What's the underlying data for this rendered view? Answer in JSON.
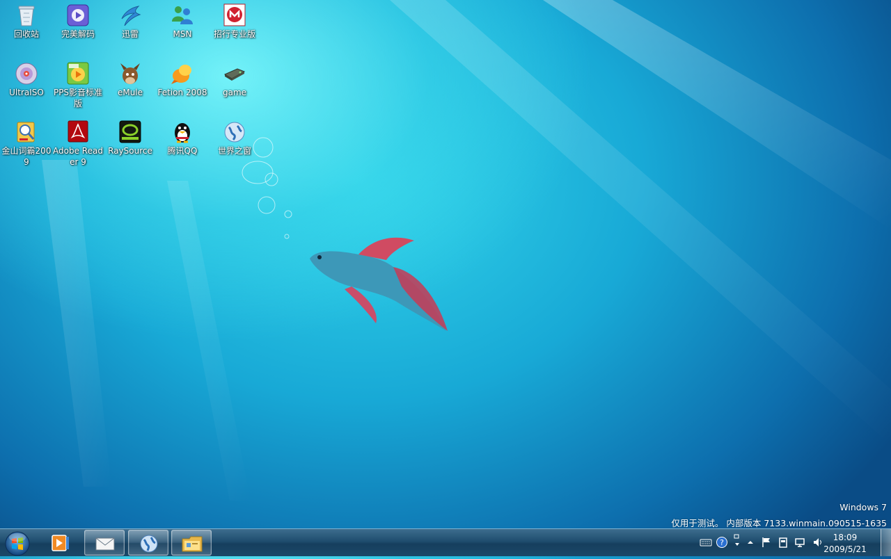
{
  "desktop": {
    "icons": [
      {
        "label": "回收站",
        "icon": "recycle-bin-icon"
      },
      {
        "label": "完美解码",
        "icon": "media-player-icon"
      },
      {
        "label": "迅雷",
        "icon": "thunder-download-icon"
      },
      {
        "label": "MSN",
        "icon": "msn-messenger-icon"
      },
      {
        "label": "招行专业版",
        "icon": "cmb-bank-icon"
      },
      {
        "label": "UltraISO",
        "icon": "disc-icon"
      },
      {
        "label": "PPS影音标准版",
        "icon": "pps-player-icon"
      },
      {
        "label": "eMule",
        "icon": "emule-mule-icon"
      },
      {
        "label": "Fetion 2008",
        "icon": "fetion-icon"
      },
      {
        "label": "game",
        "icon": "game-drive-icon"
      },
      {
        "label": "金山词霸2009",
        "icon": "dictionary-icon"
      },
      {
        "label": "Adobe Reader 9",
        "icon": "adobe-reader-icon"
      },
      {
        "label": "RaySource",
        "icon": "raysource-icon"
      },
      {
        "label": "腾讯QQ",
        "icon": "qq-penguin-icon"
      },
      {
        "label": "世界之窗",
        "icon": "world-browser-icon"
      }
    ]
  },
  "watermark": {
    "line1": "Windows 7",
    "line2": "仅用于测试。 内部版本 7133.winmain.090515-1635"
  },
  "taskbar": {
    "start_icon": "windows-orb-icon",
    "buttons": [
      {
        "icon": "media-player-icon",
        "state": "pinned"
      },
      {
        "icon": "mail-envelope-icon",
        "state": "open"
      },
      {
        "icon": "globe-browser-icon",
        "state": "open"
      },
      {
        "icon": "folder-explorer-icon",
        "state": "open"
      }
    ],
    "tray": {
      "icons": [
        "keyboard-icon",
        "help-icon",
        "language-bar-icon",
        "show-hidden-icons-icon",
        "action-center-flag-icon",
        "device-icon",
        "network-icon",
        "volume-icon"
      ]
    },
    "clock": {
      "time": "18:09",
      "date": "2009/5/21"
    }
  },
  "colors": {
    "wallpaper_light": "#33d6ea",
    "wallpaper_dark": "#0a4c86",
    "taskbar": "#1f4d6e"
  }
}
